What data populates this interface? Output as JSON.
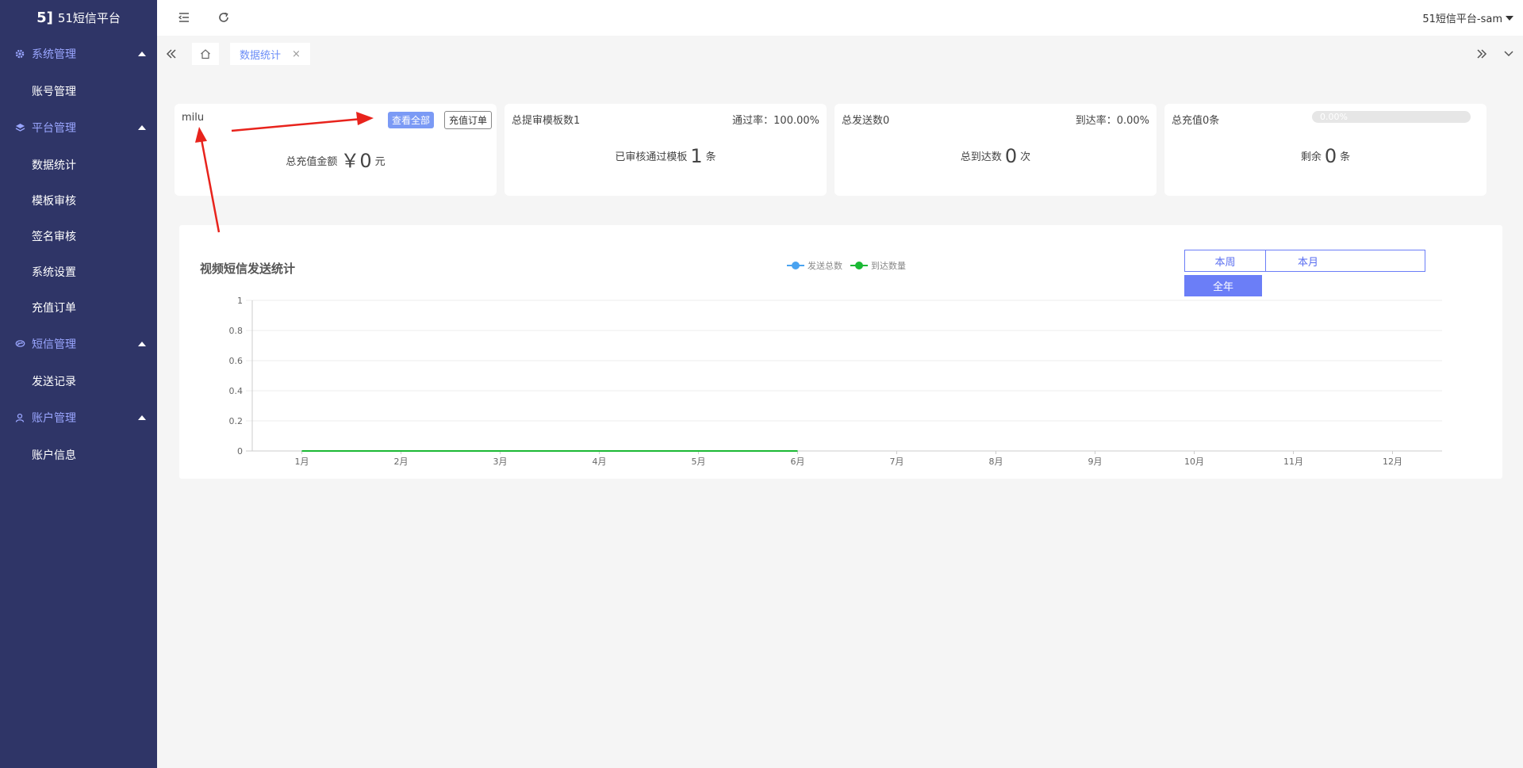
{
  "app": {
    "logo_text": "51短信平台",
    "logo_mark": "5]"
  },
  "sidebar": {
    "groups": [
      {
        "label": "系统管理",
        "icon": "gear-icon",
        "items": [
          "账号管理"
        ]
      },
      {
        "label": "平台管理",
        "icon": "layers-icon",
        "items": [
          "数据统计",
          "模板审核",
          "签名审核",
          "系统设置",
          "充值订单"
        ]
      },
      {
        "label": "短信管理",
        "icon": "message-icon",
        "items": [
          "发送记录"
        ]
      },
      {
        "label": "账户管理",
        "icon": "user-icon",
        "items": [
          "账户信息"
        ]
      }
    ]
  },
  "topbar": {
    "user": "51短信平台-sam"
  },
  "tabs": {
    "active": "数据统计",
    "close": "×"
  },
  "cards": {
    "c1": {
      "name": "milu",
      "btn_all": "查看全部",
      "btn_order": "充值订单",
      "label": "总充值金额",
      "value": "￥0",
      "unit": "元"
    },
    "c2": {
      "left": "总提审模板数1",
      "right": "通过率：100.00%",
      "label": "已审核通过模板",
      "value": "1",
      "unit": "条"
    },
    "c3": {
      "left": "总发送数0",
      "right": "到达率：0.00%",
      "label": "总到达数",
      "value": "0",
      "unit": "次"
    },
    "c4": {
      "left": "总充值0条",
      "progress_text": "0.00%",
      "progress": 0,
      "label": "剩余",
      "value": "0",
      "unit": "条"
    }
  },
  "chart_panel": {
    "title": "视频短信发送统计",
    "periods": {
      "week": "本周",
      "month": "本月",
      "year": "全年"
    }
  },
  "colors": {
    "sidebar": "#2f3567",
    "accent": "#6b7ef7",
    "series_sent": "#4aa3f0",
    "series_arrived": "#1bb934",
    "annotation": "#e8231c"
  },
  "chart_data": {
    "type": "line",
    "title": "视频短信发送统计",
    "categories": [
      "1月",
      "2月",
      "3月",
      "4月",
      "5月",
      "6月",
      "7月",
      "8月",
      "9月",
      "10月",
      "11月",
      "12月"
    ],
    "series": [
      {
        "name": "发送总数",
        "values": [
          0,
          0,
          0,
          0,
          0,
          0,
          null,
          null,
          null,
          null,
          null,
          null
        ],
        "color": "#4aa3f0"
      },
      {
        "name": "到达数量",
        "values": [
          0,
          0,
          0,
          0,
          0,
          0,
          null,
          null,
          null,
          null,
          null,
          null
        ],
        "color": "#1bb934"
      }
    ],
    "yticks": [
      "0",
      "0.2",
      "0.4",
      "0.6",
      "0.8",
      "1"
    ],
    "ylim": [
      0,
      1
    ],
    "grid": true,
    "legend": "top-center"
  }
}
